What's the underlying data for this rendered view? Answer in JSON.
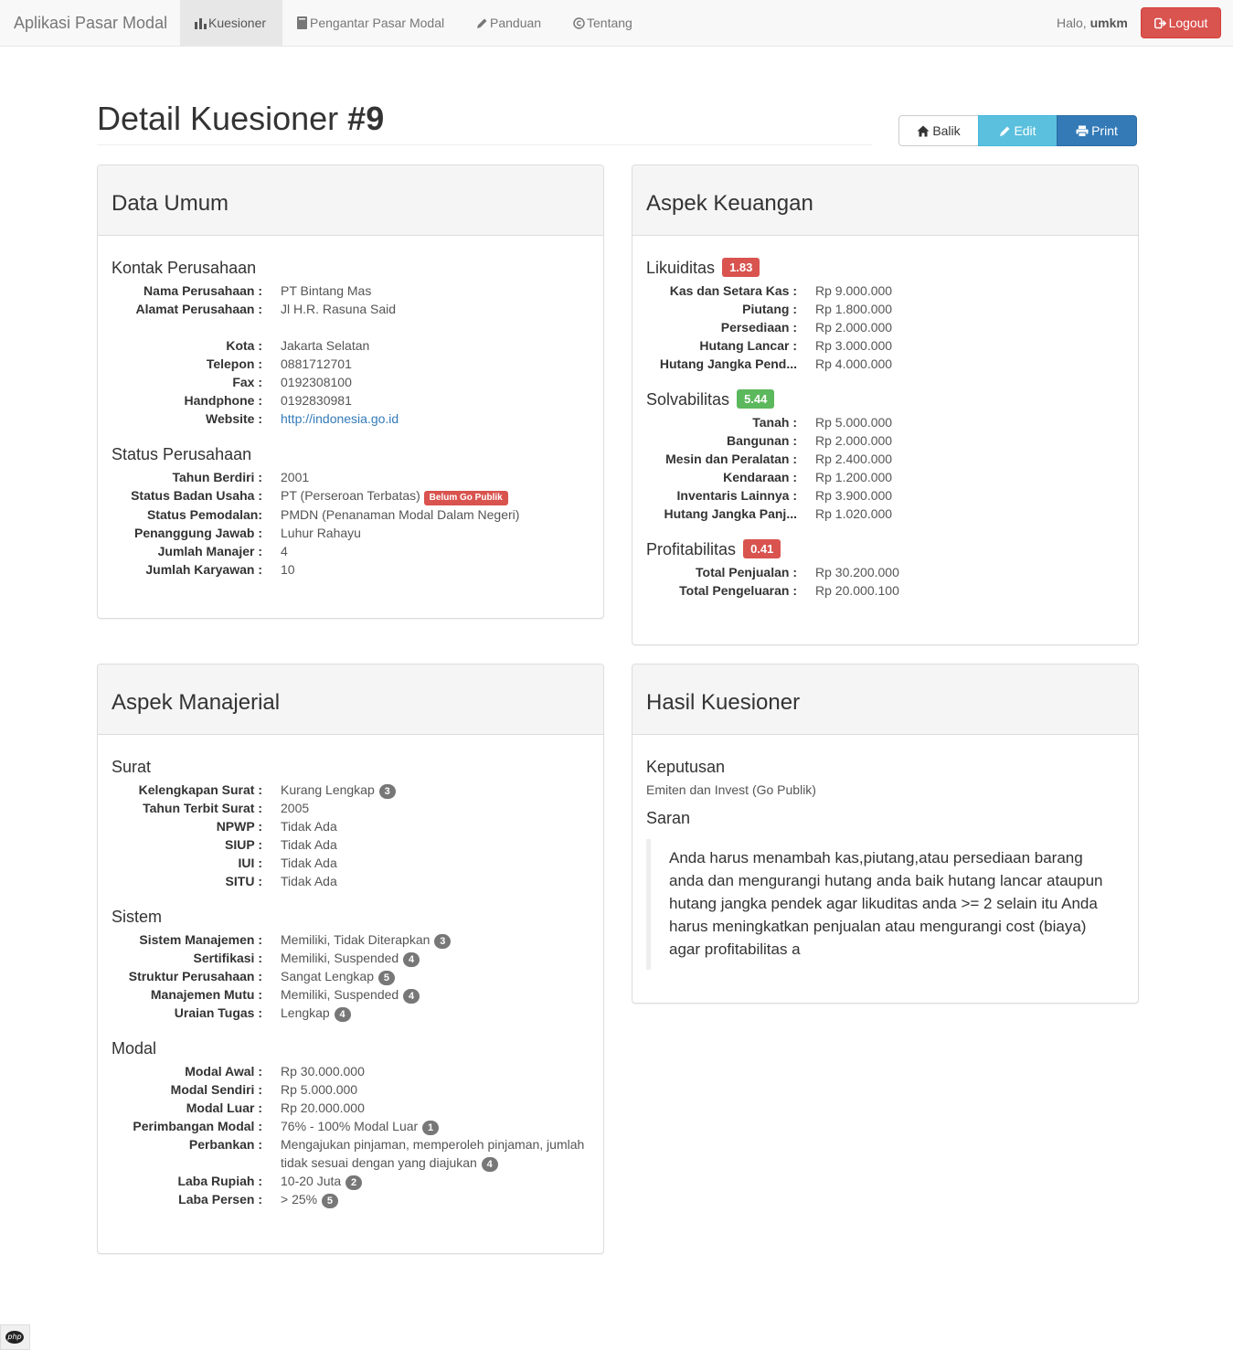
{
  "navbar": {
    "brand": "Aplikasi Pasar Modal",
    "items": [
      {
        "label": "Kuesioner",
        "icon": "bar-chart-icon"
      },
      {
        "label": "Pengantar Pasar Modal",
        "icon": "book-icon"
      },
      {
        "label": "Panduan",
        "icon": "pencil-icon"
      },
      {
        "label": "Tentang",
        "icon": "copyright-icon"
      }
    ],
    "greeting": "Halo,",
    "username": "umkm",
    "logout_label": "Logout"
  },
  "page": {
    "title_prefix": "Detail Kuesioner",
    "title_number": "#9",
    "buttons": {
      "back": "Balik",
      "edit": "Edit",
      "print": "Print"
    }
  },
  "data_umum": {
    "heading": "Data Umum",
    "kontak": {
      "title": "Kontak Perusahaan",
      "nama": {
        "k": "Nama Perusahaan :",
        "v": "PT Bintang Mas"
      },
      "alamat": {
        "k": "Alamat Perusahaan :",
        "v": "Jl H.R. Rasuna Said"
      },
      "kota": {
        "k": "Kota :",
        "v": "Jakarta Selatan"
      },
      "telepon": {
        "k": "Telepon :",
        "v": "0881712701"
      },
      "fax": {
        "k": "Fax :",
        "v": "0192308100"
      },
      "handphone": {
        "k": "Handphone :",
        "v": "0192830981"
      },
      "website": {
        "k": "Website :",
        "v": "http://indonesia.go.id"
      }
    },
    "status": {
      "title": "Status Perusahaan",
      "tahun": {
        "k": "Tahun Berdiri :",
        "v": "2001"
      },
      "badan": {
        "k": "Status Badan Usaha :",
        "v": "PT (Perseroan Terbatas)",
        "label": "Belum Go Publik"
      },
      "pemodalan": {
        "k": "Status Pemodalan:",
        "v": "PMDN (Penanaman Modal Dalam Negeri)"
      },
      "penanggung": {
        "k": "Penanggung Jawab :",
        "v": "Luhur Rahayu"
      },
      "manajer": {
        "k": "Jumlah Manajer :",
        "v": "4"
      },
      "karyawan": {
        "k": "Jumlah Karyawan :",
        "v": "10"
      }
    }
  },
  "keuangan": {
    "heading": "Aspek Keuangan",
    "likuiditas": {
      "title": "Likuiditas",
      "score": "1.83",
      "rows": [
        {
          "k": "Kas dan Setara Kas :",
          "v": "Rp 9.000.000"
        },
        {
          "k": "Piutang :",
          "v": "Rp 1.800.000"
        },
        {
          "k": "Persediaan :",
          "v": "Rp 2.000.000"
        },
        {
          "k": "Hutang Lancar :",
          "v": "Rp 3.000.000"
        },
        {
          "k": "Hutang Jangka Pend...",
          "v": "Rp 4.000.000"
        }
      ]
    },
    "solvabilitas": {
      "title": "Solvabilitas",
      "score": "5.44",
      "rows": [
        {
          "k": "Tanah :",
          "v": "Rp 5.000.000"
        },
        {
          "k": "Bangunan :",
          "v": "Rp 2.000.000"
        },
        {
          "k": "Mesin dan Peralatan :",
          "v": "Rp 2.400.000"
        },
        {
          "k": "Kendaraan :",
          "v": "Rp 1.200.000"
        },
        {
          "k": "Inventaris Lainnya :",
          "v": "Rp 3.900.000"
        },
        {
          "k": "Hutang Jangka Panj...",
          "v": "Rp 1.020.000"
        }
      ]
    },
    "profitabilitas": {
      "title": "Profitabilitas",
      "score": "0.41",
      "rows": [
        {
          "k": "Total Penjualan :",
          "v": "Rp 30.200.000"
        },
        {
          "k": "Total Pengeluaran :",
          "v": "Rp 20.000.100"
        }
      ]
    }
  },
  "manajerial": {
    "heading": "Aspek Manajerial",
    "surat": {
      "title": "Surat",
      "rows": [
        {
          "k": "Kelengkapan Surat :",
          "v": "Kurang Lengkap",
          "badge": "3"
        },
        {
          "k": "Tahun Terbit Surat :",
          "v": "2005"
        },
        {
          "k": "NPWP :",
          "v": "Tidak Ada"
        },
        {
          "k": "SIUP :",
          "v": "Tidak Ada"
        },
        {
          "k": "IUI :",
          "v": "Tidak Ada"
        },
        {
          "k": "SITU :",
          "v": "Tidak Ada"
        }
      ]
    },
    "sistem": {
      "title": "Sistem",
      "rows": [
        {
          "k": "Sistem Manajemen :",
          "v": "Memiliki, Tidak Diterapkan",
          "badge": "3"
        },
        {
          "k": "Sertifikasi :",
          "v": "Memiliki, Suspended",
          "badge": "4"
        },
        {
          "k": "Struktur Perusahaan :",
          "v": "Sangat Lengkap",
          "badge": "5"
        },
        {
          "k": "Manajemen Mutu :",
          "v": "Memiliki, Suspended",
          "badge": "4"
        },
        {
          "k": "Uraian Tugas :",
          "v": "Lengkap",
          "badge": "4"
        }
      ]
    },
    "modal": {
      "title": "Modal",
      "rows": [
        {
          "k": "Modal Awal :",
          "v": "Rp 30.000.000"
        },
        {
          "k": "Modal Sendiri :",
          "v": "Rp 5.000.000"
        },
        {
          "k": "Modal Luar :",
          "v": "Rp 20.000.000"
        },
        {
          "k": "Perimbangan Modal :",
          "v": "76% - 100% Modal Luar",
          "badge": "1"
        },
        {
          "k": "Perbankan :",
          "v": "Mengajukan pinjaman, memperoleh pinjaman, jumlah tidak sesuai dengan yang diajukan",
          "badge": "4"
        },
        {
          "k": "Laba Rupiah :",
          "v": "10-20 Juta",
          "badge": "2"
        },
        {
          "k": "Laba Persen :",
          "v": "> 25%",
          "badge": "5"
        }
      ]
    }
  },
  "hasil": {
    "heading": "Hasil Kuesioner",
    "keputusan_title": "Keputusan",
    "keputusan": "Emiten dan Invest (Go Publik)",
    "saran_title": "Saran",
    "saran": "Anda harus menambah kas,piutang,atau persediaan barang anda dan mengurangi hutang anda baik hutang lancar ataupun hutang jangka pendek agar likuditas anda >= 2 selain itu Anda harus meningkatkan penjualan atau mengurangi cost (biaya) agar profitabilitas a"
  },
  "footer": {
    "php_badge": "php"
  },
  "colors": {
    "danger": "#d9534f",
    "success": "#5cb85c",
    "info": "#5bc0de",
    "primary": "#337ab7",
    "badge": "#777777"
  }
}
